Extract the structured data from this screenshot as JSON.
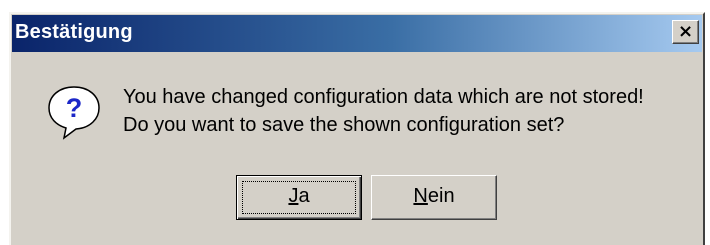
{
  "window": {
    "title": "Bestätigung",
    "close_label": "×"
  },
  "icon": {
    "name": "question-icon",
    "glyph": "?"
  },
  "message": {
    "line1": "You have changed configuration data which are not stored!",
    "line2": "Do you want to save the shown configuration set?"
  },
  "buttons": {
    "yes": {
      "mnemonic": "J",
      "rest": "a"
    },
    "no": {
      "mnemonic": "N",
      "rest": "ein"
    }
  },
  "colors": {
    "dialog_face": "#d4d0c8",
    "titlebar_start": "#0a246a",
    "titlebar_end": "#a6caf0",
    "icon_blue": "#1c27c8"
  }
}
